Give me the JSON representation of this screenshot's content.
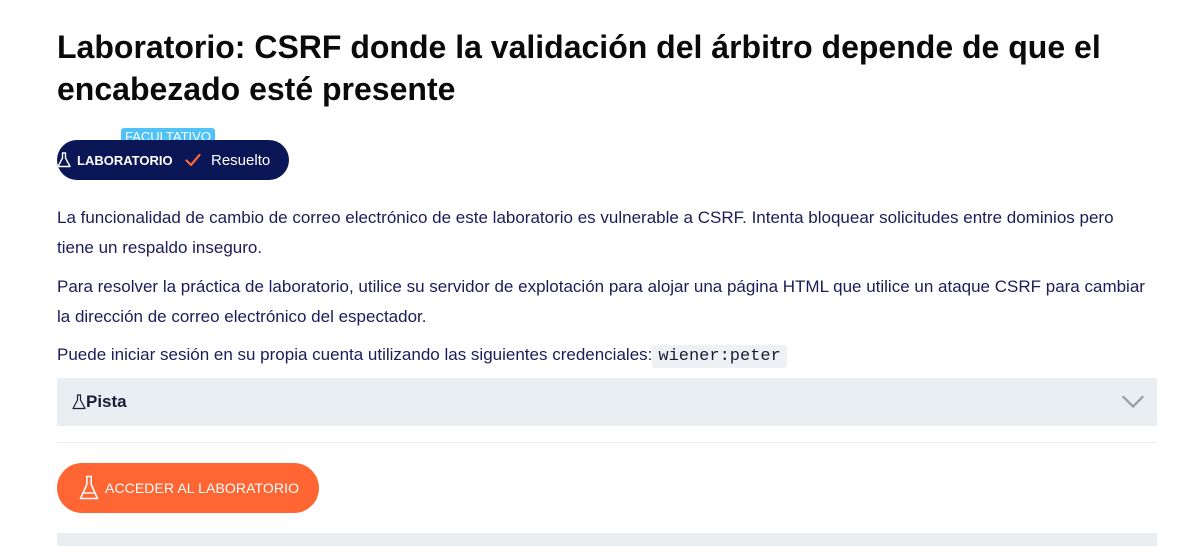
{
  "lab": {
    "title": "Laboratorio: CSRF donde la validación del árbitro depende de que el encabezado esté presente",
    "optional_tag": "FACULTATIVO",
    "type_label": "LABORATORIO",
    "status_label": "Resuelto"
  },
  "description": {
    "p1": "La funcionalidad de cambio de correo electrónico de este laboratorio es vulnerable a CSRF. Intenta bloquear solicitudes entre dominios pero tiene un respaldo inseguro.",
    "p2": "Para resolver la práctica de laboratorio, utilice su servidor de explotación para alojar una página HTML que utilice un ataque CSRF para cambiar la dirección de correo electrónico del espectador.",
    "p3": "Puede iniciar sesión en su propia cuenta utilizando las siguientes credenciales:",
    "credentials": "wiener:peter"
  },
  "hint": {
    "label": "Pista"
  },
  "access_button": {
    "label": "ACCEDER AL LABORATORIO"
  },
  "colors": {
    "badge_bg": "#0a1656",
    "optional_tag_bg": "#4fc3f7",
    "check": "#ff6633",
    "button_bg": "#ff6633",
    "hint_bg": "#e9eef2",
    "text": "#1c1c5a"
  },
  "icons": {
    "flask": "flask-icon",
    "check": "check-icon",
    "chevron": "chevron-down-icon"
  }
}
